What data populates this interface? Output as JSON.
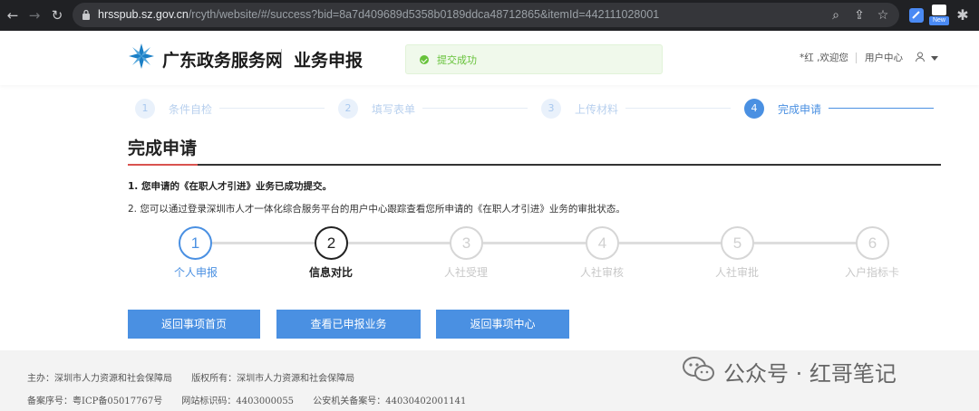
{
  "browser": {
    "url_host": "hrsspub.sz.gov.cn",
    "url_path": "/rcyth/website/#/success?bid=8a7d409689d5358b0189ddca48712865&itemId=442111028001",
    "ext_badge": "New"
  },
  "header": {
    "site_name": "广东政务服务网",
    "sub_name": "业务申报",
    "toast": "提交成功",
    "welcome": "*红 ,欢迎您",
    "user_center": "用户中心"
  },
  "top_steps": [
    {
      "num": "1",
      "label": "条件自检",
      "active": false
    },
    {
      "num": "2",
      "label": "填写表单",
      "active": false
    },
    {
      "num": "3",
      "label": "上传材料",
      "active": false
    },
    {
      "num": "4",
      "label": "完成申请",
      "active": true
    }
  ],
  "main": {
    "title": "完成申请",
    "msg1": "1. 您申请的《在职人才引进》业务已成功提交。",
    "msg2": "2. 您可以通过登录深圳市人才一体化综合服务平台的用户中心跟踪查看您所申请的《在职人才引进》业务的审批状态。"
  },
  "progress_steps": [
    {
      "num": "1",
      "label": "个人申报",
      "state": "done"
    },
    {
      "num": "2",
      "label": "信息对比",
      "state": "current"
    },
    {
      "num": "3",
      "label": "人社受理",
      "state": "pending"
    },
    {
      "num": "4",
      "label": "人社审核",
      "state": "pending"
    },
    {
      "num": "5",
      "label": "人社审批",
      "state": "pending"
    },
    {
      "num": "6",
      "label": "入户指标卡",
      "state": "pending"
    }
  ],
  "buttons": {
    "back_home": "返回事项首页",
    "view_submitted": "查看已申报业务",
    "back_center": "返回事项中心"
  },
  "footer": {
    "host": "主办：深圳市人力资源和社会保障局",
    "copyright": "版权所有：深圳市人力资源和社会保障局",
    "icp": "备案序号：粤ICP备05017767号",
    "site_code": "网站标识码：4403000055",
    "police": "公安机关备案号：44030402001141"
  },
  "watermark": "公众号 · 红哥笔记",
  "colors": {
    "accent": "#4a90e2",
    "success": "#67c23a",
    "title_red": "#d9534f"
  }
}
